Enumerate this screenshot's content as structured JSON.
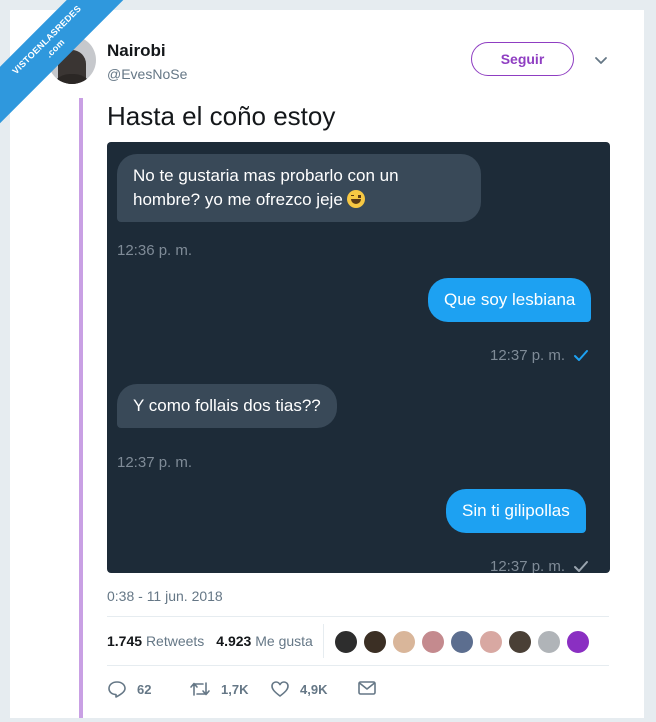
{
  "author": {
    "name": "Nairobi",
    "handle": "@EvesNoSe"
  },
  "follow_label": "Seguir",
  "tweet_text": "Hasta el coño estoy",
  "chat": [
    {
      "dir": "in",
      "text": "No te gustaria mas probarlo con un hombre? yo me ofrezco jeje",
      "time": "12:36 p. m.",
      "emoji": "grinning-sweat-emoji"
    },
    {
      "dir": "out",
      "text": "Que soy lesbiana",
      "time": "12:37 p. m.",
      "status": "delivered-blue"
    },
    {
      "dir": "in",
      "text": "Y como follais dos tias??",
      "time": "12:37 p. m."
    },
    {
      "dir": "out",
      "text": "Sin ti gilipollas",
      "time": "12:37 p. m.",
      "status": "sent-gray"
    }
  ],
  "timestamp": "0:38 - 11 jun. 2018",
  "stats": {
    "retweets_count": "1.745",
    "retweets_label": "Retweets",
    "likes_count": "4.923",
    "likes_label": "Me gusta"
  },
  "actions": {
    "replies": "62",
    "retweets": "1,7K",
    "likes": "4,9K"
  },
  "watermark": {
    "line1": "VISTOENLASREDES",
    "line2": ".com"
  },
  "colors": {
    "accent": "#8f3ec2",
    "chat_bg": "#1d2b38",
    "bubble_in": "#394958",
    "bubble_out": "#1da1f2",
    "watermark": "#2f98dd"
  }
}
